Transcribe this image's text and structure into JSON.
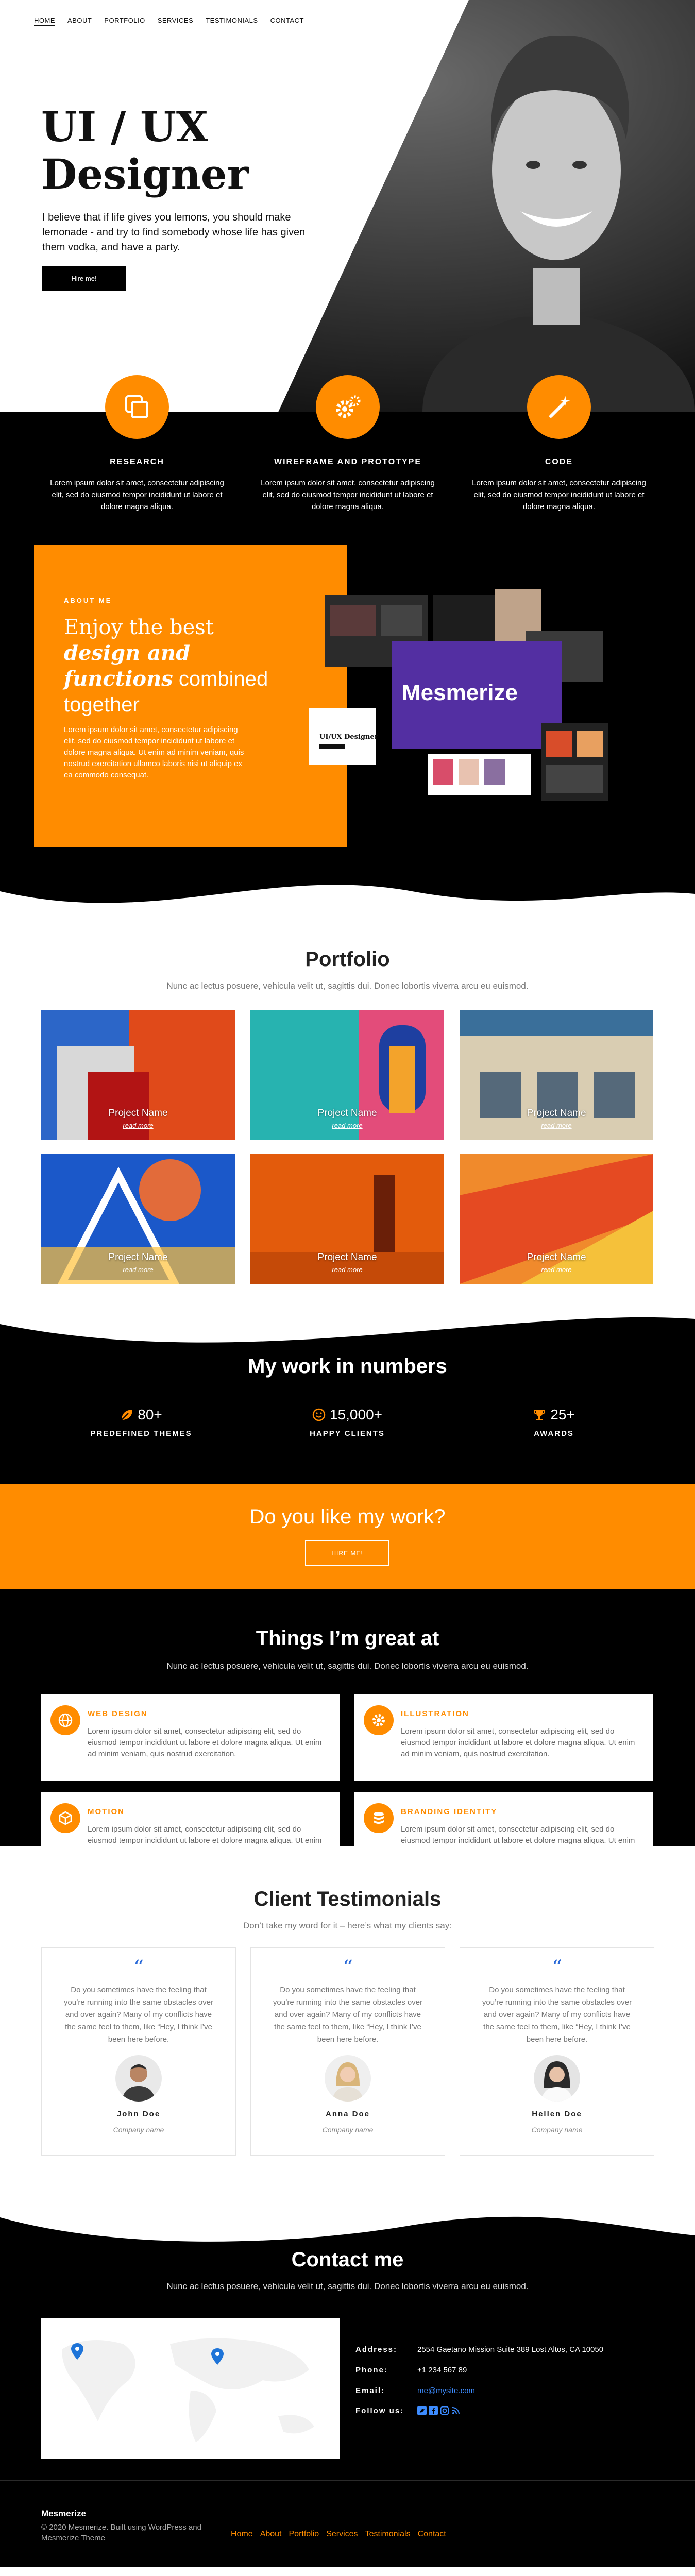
{
  "nav": {
    "items": [
      {
        "label": "HOME",
        "active": true
      },
      {
        "label": "ABOUT"
      },
      {
        "label": "PORTFOLIO"
      },
      {
        "label": "SERVICES"
      },
      {
        "label": "TESTIMONIALS"
      },
      {
        "label": "CONTACT"
      }
    ]
  },
  "hero": {
    "title_line1": "UI / UX",
    "title_line2": "Designer",
    "text": "I believe that if life gives you lemons, you should make lemonade - and try to find somebody whose life has given them vodka, and have a party.",
    "button": "Hire me!"
  },
  "services": [
    {
      "title": "RESEARCH",
      "icon": "copy-icon",
      "text": "Lorem ipsum dolor sit amet, consectetur adipiscing elit, sed do eiusmod tempor incididunt ut labore et dolore magna aliqua."
    },
    {
      "title": "WIREFRAME AND PROTOTYPE",
      "icon": "gears-icon",
      "text": "Lorem ipsum dolor sit amet, consectetur adipiscing elit, sed do eiusmod tempor incididunt ut labore et dolore magna aliqua."
    },
    {
      "title": "CODE",
      "icon": "magic-wand-icon",
      "text": "Lorem ipsum dolor sit amet, consectetur adipiscing elit, sed do eiusmod tempor incididunt ut labore et dolore magna aliqua."
    }
  ],
  "about": {
    "label": "ABOUT ME",
    "title_a": "Enjoy the best",
    "title_b": "design and",
    "title_c": "functions",
    "title_d": "combined",
    "title_e": "together",
    "body": "Lorem ipsum dolor sit amet, consectetur adipiscing elit, sed do eiusmod tempor incididunt ut labore et dolore magna aliqua. Ut enim ad minim veniam, quis nostrud exercitation ullamco laboris nisi ut aliquip ex ea commodo consequat.",
    "mock_heading": "Mesmerize",
    "mock_card": "UI/UX Designer"
  },
  "portfolio": {
    "title": "Portfolio",
    "subtitle": "Nunc ac lectus posuere, vehicula velit ut, sagittis dui. Donec lobortis viverra arcu eu euismod.",
    "projects": [
      {
        "name": "Project Name",
        "link": "read more"
      },
      {
        "name": "Project Name",
        "link": "read more"
      },
      {
        "name": "Project Name",
        "link": "read more"
      },
      {
        "name": "Project Name",
        "link": "read more"
      },
      {
        "name": "Project Name",
        "link": "read more"
      },
      {
        "name": "Project Name",
        "link": "read more"
      }
    ]
  },
  "numbers": {
    "title": "My work in numbers",
    "stats": [
      {
        "value": "80+",
        "label": "PREDEFINED THEMES",
        "icon": "leaf-icon"
      },
      {
        "value": "15,000+",
        "label": "HAPPY CLIENTS",
        "icon": "smile-icon"
      },
      {
        "value": "25+",
        "label": "AWARDS",
        "icon": "trophy-icon"
      }
    ]
  },
  "cta": {
    "title": "Do you like my work?",
    "button": "HIRE ME!"
  },
  "skills": {
    "title": "Things I’m great at",
    "subtitle": "Nunc ac lectus posuere, vehicula velit ut, sagittis dui. Donec lobortis viverra arcu eu euismod.",
    "items": [
      {
        "title": "WEB DESIGN",
        "icon": "globe-icon",
        "text": "Lorem ipsum dolor sit amet, consectetur adipiscing elit, sed do eiusmod tempor incididunt ut labore et dolore magna aliqua. Ut enim ad minim veniam, quis nostrud exercitation."
      },
      {
        "title": "ILLUSTRATION",
        "icon": "gear-icon",
        "text": "Lorem ipsum dolor sit amet, consectetur adipiscing elit, sed do eiusmod tempor incididunt ut labore et dolore magna aliqua. Ut enim ad minim veniam, quis nostrud exercitation."
      },
      {
        "title": "MOTION",
        "icon": "cube-icon",
        "text": "Lorem ipsum dolor sit amet, consectetur adipiscing elit, sed do eiusmod tempor incididunt ut labore et dolore magna aliqua. Ut enim ad minim veniam, quis nostrud exercitation."
      },
      {
        "title": "BRANDING IDENTITY",
        "icon": "database-icon",
        "text": "Lorem ipsum dolor sit amet, consectetur adipiscing elit, sed do eiusmod tempor incididunt ut labore et dolore magna aliqua. Ut enim ad minim veniam, quis nostrud exercitation."
      }
    ]
  },
  "testimonials": {
    "title": "Client Testimonials",
    "subtitle": "Don’t take my word for it – here’s what my clients say:",
    "items": [
      {
        "quote": "Do you sometimes have the feeling that you’re running into the same obstacles over and over again? Many of my conflicts have the same feel to them, like “Hey, I think I’ve been here before.",
        "name": "John Doe",
        "company": "Company name"
      },
      {
        "quote": "Do you sometimes have the feeling that you’re running into the same obstacles over and over again? Many of my conflicts have the same feel to them, like “Hey, I think I’ve been here before.",
        "name": "Anna Doe",
        "company": "Company name"
      },
      {
        "quote": "Do you sometimes have the feeling that you’re running into the same obstacles over and over again? Many of my conflicts have the same feel to them, like “Hey, I think I’ve been here before.",
        "name": "Hellen Doe",
        "company": "Company name"
      }
    ]
  },
  "contact": {
    "title": "Contact me",
    "subtitle": "Nunc ac lectus posuere, vehicula velit ut, sagittis dui. Donec lobortis viverra arcu eu euismod.",
    "address_label": "Address:",
    "address": "2554 Gaetano Mission Suite 389 Lost Altos, CA 10050",
    "phone_label": "Phone:",
    "phone": "+1 234 567 89",
    "email_label": "Email:",
    "email": "me@mysite.com",
    "follow_label": "Follow us:"
  },
  "footer": {
    "brand": "Mesmerize",
    "copy": "© 2020 Mesmerize. Built using WordPress and",
    "theme_link": "Mesmerize Theme",
    "links": [
      "Home",
      "About",
      "Portfolio",
      "Services",
      "Testimonials",
      "Contact"
    ]
  },
  "colors": {
    "accent": "#ff8c00",
    "dark": "#000000",
    "link": "#3d8cff"
  }
}
